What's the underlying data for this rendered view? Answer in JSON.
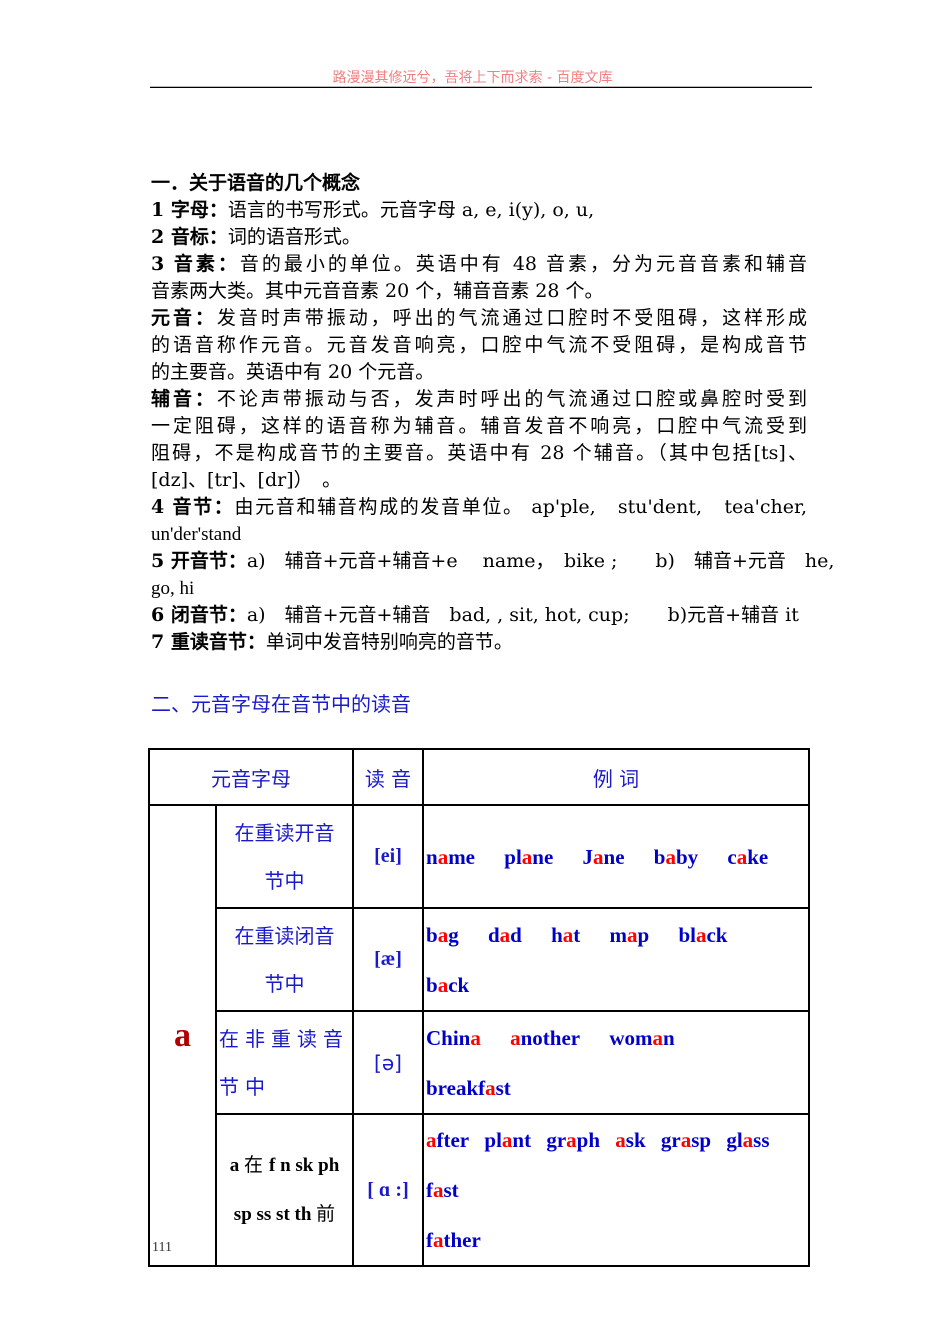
{
  "header": {
    "text": "路漫漫其修远兮，吾将上下而求索 - 百度文库"
  },
  "section1": {
    "title": "一．关于语音的几个概念",
    "items": [
      {
        "label": "1 字母：",
        "text": "语言的书写形式。元音字母 a, e, i(y), o, u,"
      },
      {
        "label": "2 音标：",
        "text": "词的语音形式。"
      },
      {
        "label": "3 音素：",
        "lines": [
          "音的最小的单位。英语中有 48 音素，分为元音音素和辅音",
          "音素两大类。其中元音音素 20 个，辅音音素 28 个。"
        ]
      },
      {
        "label": "元音：",
        "lines": [
          "发音时声带振动，呼出的气流通过口腔时不受阻碍，这样形成",
          "的语音称作元音。元音发音响亮，口腔中气流不受阻碍，是构成音节",
          "的主要音。英语中有 20 个元音。"
        ]
      },
      {
        "label": "辅音：",
        "lines": [
          "不论声带振动与否，发声时呼出的气流通过口腔或鼻腔时受到",
          "一定阻碍，这样的语音称为辅音。辅音发音不响亮，口腔中气流受到",
          "阻碍，不是构成音节的主要音。英语中有 28 个辅音。（其中包括[ts]、",
          "[dz]、[tr]、[dr]）　。"
        ]
      },
      {
        "label": "4 音节：",
        "lines": [
          "由元音和辅音构成的发音单位。 ap'ple,　stu'dent,　tea'cher,",
          "un'der'stand"
        ]
      },
      {
        "label": "5 开音节：",
        "lines": [
          "a)　辅音+元音+辅音+e　 name，　bike ;　　b)　辅音+元音　he,",
          "go, hi"
        ]
      },
      {
        "label": "6 闭音节：",
        "text": "a)　辅音+元音+辅音　bad, , sit, hot, cup;　　b)元音+辅音 it"
      },
      {
        "label": "7 重读音节：",
        "text": "单词中发音特别响亮的音节。"
      }
    ]
  },
  "section2": {
    "title": "二、元音字母在音节中的读音"
  },
  "table": {
    "headers": {
      "letter": "元音字母",
      "sound": "读 音",
      "examples": "例 词"
    },
    "letter": "a",
    "colors": {
      "text": "#0000c8",
      "highlight": "#ff0000",
      "letter": "#b00000"
    },
    "rows": [
      {
        "condition": [
          "在重读开音",
          "节中"
        ],
        "ipa": "[ei]",
        "examples": [
          {
            "parts": [
              [
                "n",
                false
              ],
              [
                "a",
                true
              ],
              [
                "me",
                false
              ]
            ]
          },
          {
            "parts": [
              [
                "pl",
                false
              ],
              [
                "a",
                true
              ],
              [
                "ne",
                false
              ]
            ]
          },
          {
            "parts": [
              [
                "J",
                false
              ],
              [
                "a",
                true
              ],
              [
                "ne",
                false
              ]
            ]
          },
          {
            "parts": [
              [
                "b",
                false
              ],
              [
                "a",
                true
              ],
              [
                "by",
                false
              ]
            ]
          },
          {
            "parts": [
              [
                "c",
                false
              ],
              [
                "a",
                true
              ],
              [
                "ke",
                false
              ]
            ]
          }
        ]
      },
      {
        "condition": [
          "在重读闭音",
          "节中"
        ],
        "ipa": "[æ]",
        "examples": [
          {
            "parts": [
              [
                "b",
                false
              ],
              [
                "a",
                true
              ],
              [
                "g",
                false
              ]
            ]
          },
          {
            "parts": [
              [
                "d",
                false
              ],
              [
                "a",
                true
              ],
              [
                "d",
                false
              ]
            ]
          },
          {
            "parts": [
              [
                "h",
                false
              ],
              [
                "a",
                true
              ],
              [
                "t",
                false
              ]
            ]
          },
          {
            "parts": [
              [
                "m",
                false
              ],
              [
                "a",
                true
              ],
              [
                "p",
                false
              ]
            ]
          },
          {
            "parts": [
              [
                "bl",
                false
              ],
              [
                "a",
                true
              ],
              [
                "ck",
                false
              ]
            ]
          },
          {
            "parts": [
              [
                "b",
                false
              ],
              [
                "a",
                true
              ],
              [
                "ck",
                false
              ]
            ]
          }
        ]
      },
      {
        "condition": [
          "在非重读音",
          "节中"
        ],
        "ipa": "[ə]",
        "examples": [
          {
            "parts": [
              [
                "Chin",
                false
              ],
              [
                "a",
                true
              ]
            ]
          },
          {
            "parts": [
              [
                "a",
                true
              ],
              [
                "nother",
                false
              ]
            ]
          },
          {
            "parts": [
              [
                "wom",
                false
              ],
              [
                "a",
                true
              ],
              [
                "n",
                false
              ]
            ]
          },
          {
            "parts": [
              [
                "breakf",
                false
              ],
              [
                "a",
                true
              ],
              [
                "st",
                false
              ]
            ]
          }
        ]
      },
      {
        "condition_parts": [
          [
            "a ",
            "en"
          ],
          [
            "在 ",
            "zh"
          ],
          [
            "f n sk ph",
            "en"
          ]
        ],
        "condition_parts2": [
          [
            "sp ss st th ",
            "en"
          ],
          [
            "前",
            "zh"
          ]
        ],
        "ipa": "[ ɑ :]",
        "examples": [
          {
            "parts": [
              [
                "a",
                true
              ],
              [
                "fter",
                false
              ]
            ]
          },
          {
            "parts": [
              [
                "pl",
                false
              ],
              [
                "a",
                true
              ],
              [
                "nt",
                false
              ]
            ]
          },
          {
            "parts": [
              [
                "gr",
                false
              ],
              [
                "a",
                true
              ],
              [
                "ph",
                false
              ]
            ]
          },
          {
            "parts": [
              [
                "a",
                true
              ],
              [
                "sk",
                false
              ]
            ]
          },
          {
            "parts": [
              [
                "gr",
                false
              ],
              [
                "a",
                true
              ],
              [
                "sp",
                false
              ]
            ]
          },
          {
            "parts": [
              [
                "gl",
                false
              ],
              [
                "a",
                true
              ],
              [
                "ss",
                false
              ]
            ]
          },
          {
            "parts": [
              [
                "f",
                false
              ],
              [
                "a",
                true
              ],
              [
                "st",
                false
              ]
            ]
          },
          {
            "parts": [
              [
                "f",
                false
              ],
              [
                "a",
                true
              ],
              [
                "ther",
                false
              ]
            ]
          }
        ]
      }
    ]
  },
  "footer": {
    "page_number": "111"
  }
}
